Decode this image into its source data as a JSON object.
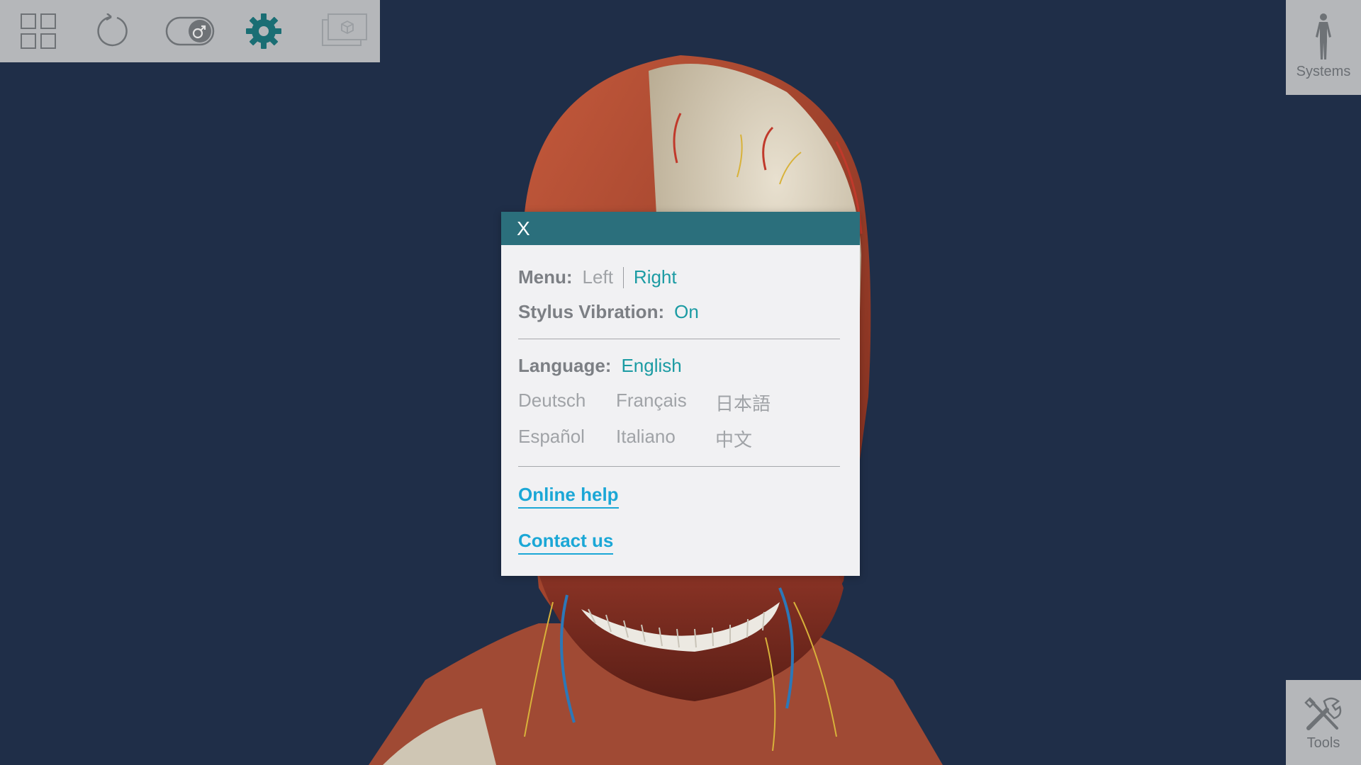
{
  "toolbar": {
    "icons": [
      "grid-icon",
      "reset-rotate-icon",
      "gender-toggle-icon",
      "settings-gear-icon",
      "screen-view-icon"
    ],
    "active_color": "#1a6e74"
  },
  "side": {
    "systems_label": "Systems",
    "tools_label": "Tools"
  },
  "dialog": {
    "close_label": "X",
    "menu_label": "Menu:",
    "menu_options": [
      "Left",
      "Right"
    ],
    "menu_selected": "Right",
    "vibration_label": "Stylus Vibration:",
    "vibration_value": "On",
    "language_label": "Language:",
    "language_value": "English",
    "languages": [
      "Deutsch",
      "Français",
      "日本語",
      "Español",
      "Italiano",
      "中文"
    ],
    "online_help": "Online help",
    "contact_us": "Contact us"
  },
  "colors": {
    "background": "#1f2e48",
    "header": "#2b6f7c",
    "accent": "#1b9ba3",
    "link": "#1ba7d6"
  }
}
